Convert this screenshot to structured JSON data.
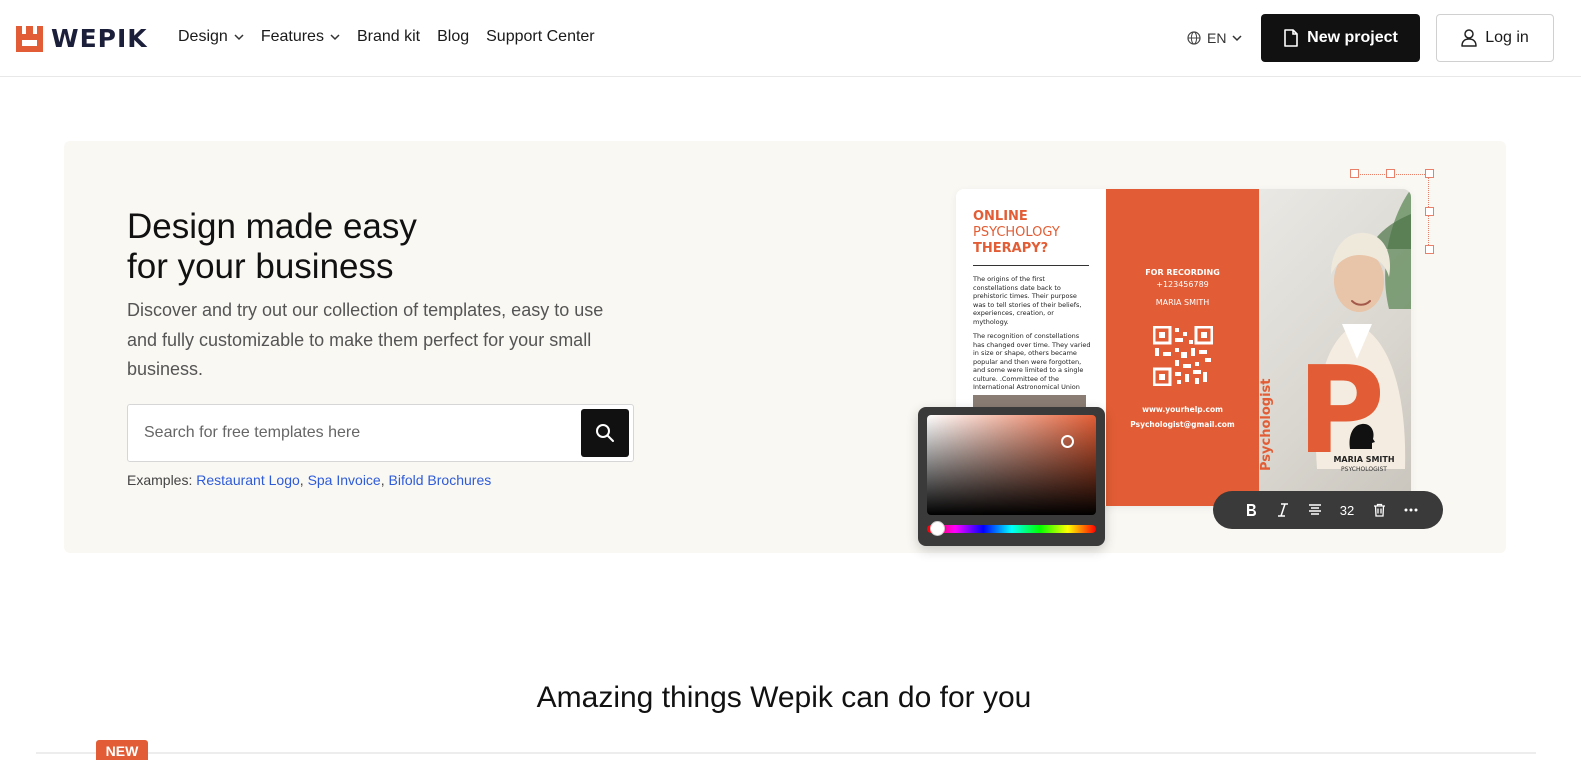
{
  "brand": {
    "name": "WEPIK",
    "accent": "#e25d35",
    "dark": "#1c1f3a"
  },
  "nav": {
    "items": [
      {
        "label": "Design",
        "has_dropdown": true
      },
      {
        "label": "Features",
        "has_dropdown": true
      },
      {
        "label": "Brand kit",
        "has_dropdown": false
      },
      {
        "label": "Blog",
        "has_dropdown": false
      },
      {
        "label": "Support Center",
        "has_dropdown": false
      }
    ],
    "language": "EN",
    "new_project_label": "New project",
    "login_label": "Log in"
  },
  "hero": {
    "title_line1": "Design made easy",
    "title_line2": "for your business",
    "description": "Discover and try out our collection of templates, easy to use and fully customizable to make them perfect for your small business.",
    "search_placeholder": "Search for free templates here",
    "examples_label": "Examples:",
    "examples": [
      "Restaurant Logo",
      "Spa Invoice",
      "Bifold Brochures"
    ]
  },
  "mockup": {
    "heading_line1": "ONLINE",
    "heading_line2": "PSYCHOLOGY",
    "heading_line3": "THERAPY?",
    "body_para1": "The origins of the first constellations date back to prehistoric times. Their purpose was to tell stories of their beliefs, experiences, creation, or mythology.",
    "body_para2": "The recognition of constellations has changed over time. They varied in size or shape, others became popular and then were forgotten, and some were limited to a single culture. .Committee of the International Astronomical Union",
    "recording_label": "FOR RECORDING",
    "phone": "+123456789",
    "mid_name": "MARIA SMITH",
    "website": "www.yourhelp.com",
    "email": "Psychologist@gmail.com",
    "big_letter": "P",
    "vertical_word": "Psychologist",
    "right_name": "MARIA SMITH",
    "right_role": "PSYCHOLOGIST",
    "font_size_value": "32"
  },
  "toolbar_icons": [
    "bold-icon",
    "italic-icon",
    "align-center-icon",
    "font-size",
    "trash-icon",
    "more-icon"
  ],
  "section": {
    "title": "Amazing things Wepik can do for you",
    "new_badge": "NEW"
  }
}
